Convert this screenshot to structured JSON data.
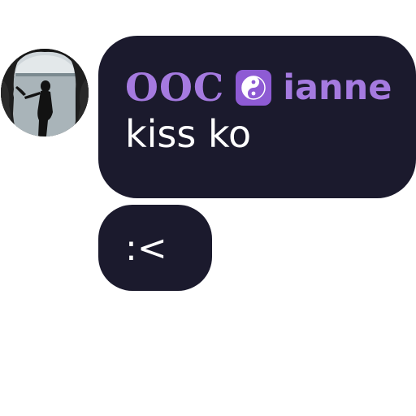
{
  "colors": {
    "accent": "#a57ae0",
    "bubble": "#1b1a2d",
    "text": "#ffffff",
    "emoji_bg": "#8e5bd4"
  },
  "avatar": {
    "icon": "profile-photo"
  },
  "messages": [
    {
      "sender_prefix": "OOC",
      "sender_emoji": "yin-yang-icon",
      "sender_name": "ianne",
      "text": "kiss ko"
    },
    {
      "text": ":<"
    }
  ]
}
